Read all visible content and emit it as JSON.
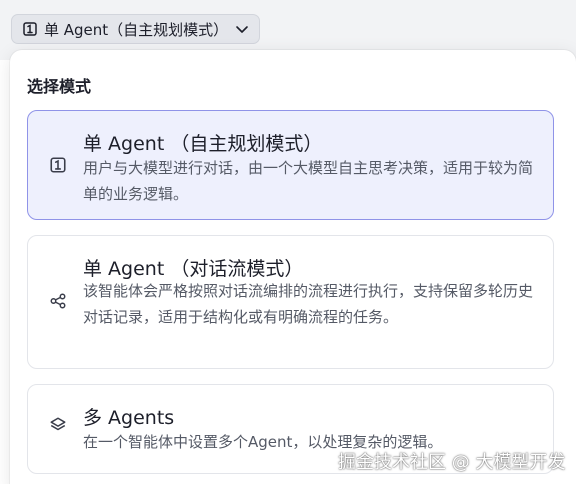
{
  "trigger": {
    "label": "单 Agent（自主规划模式）"
  },
  "panel": {
    "title": "选择模式",
    "options": [
      {
        "title": "单 Agent （自主规划模式）",
        "description": "用户与大模型进行对话，由一个大模型自主思考决策，适用于较为简单的业务逻辑。",
        "icon": "agent-plan-icon",
        "selected": true
      },
      {
        "title": "单 Agent （对话流模式）",
        "description": "该智能体会严格按照对话流编排的流程进行执行，支持保留多轮历史对话记录，适用于结构化或有明确流程的任务。",
        "icon": "workflow-icon",
        "selected": false
      },
      {
        "title": "多 Agents",
        "description": "在一个智能体中设置多个Agent，以处理复杂的逻辑。",
        "icon": "layers-icon",
        "selected": false
      }
    ]
  },
  "watermark": "掘金技术社区 @ 大模型开发",
  "colors": {
    "accent": "#8f93e8",
    "selected_bg": "#eef0fd"
  }
}
